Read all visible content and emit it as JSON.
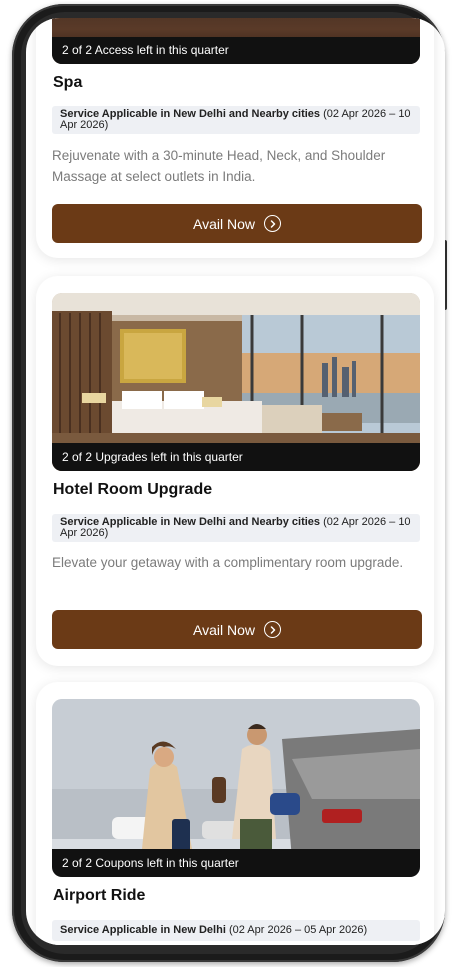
{
  "cards": [
    {
      "badge": "2 of 2 Access left in this quarter",
      "title": "Spa",
      "service_label": "Service Applicable in New Delhi and Nearby cities",
      "service_dates": "(02 Apr 2026 – 10 Apr 2026)",
      "description": "Rejuvenate with a 30-minute Head, Neck, and Shoulder Massage at select outlets in India.",
      "button": "Avail Now"
    },
    {
      "badge": "2 of 2 Upgrades left in this quarter",
      "title": "Hotel Room Upgrade",
      "service_label": "Service Applicable in New Delhi and Nearby cities",
      "service_dates": "(02 Apr 2026 – 10 Apr 2026)",
      "description": "Elevate your getaway with a complimentary room upgrade.",
      "button": "Avail Now"
    },
    {
      "badge": "2 of 2 Coupons left in this quarter",
      "title": "Airport Ride",
      "service_label": "Service Applicable in New Delhi",
      "service_dates": "(02 Apr 2026 – 05 Apr 2026)"
    }
  ],
  "colors": {
    "button_brown": "#6b3a16",
    "badge_black": "#111111",
    "service_bg": "#eef0f4",
    "desc_gray": "#7b7b7b"
  },
  "icons": {
    "avail_button_icon": "chevron-right-circle-icon"
  }
}
